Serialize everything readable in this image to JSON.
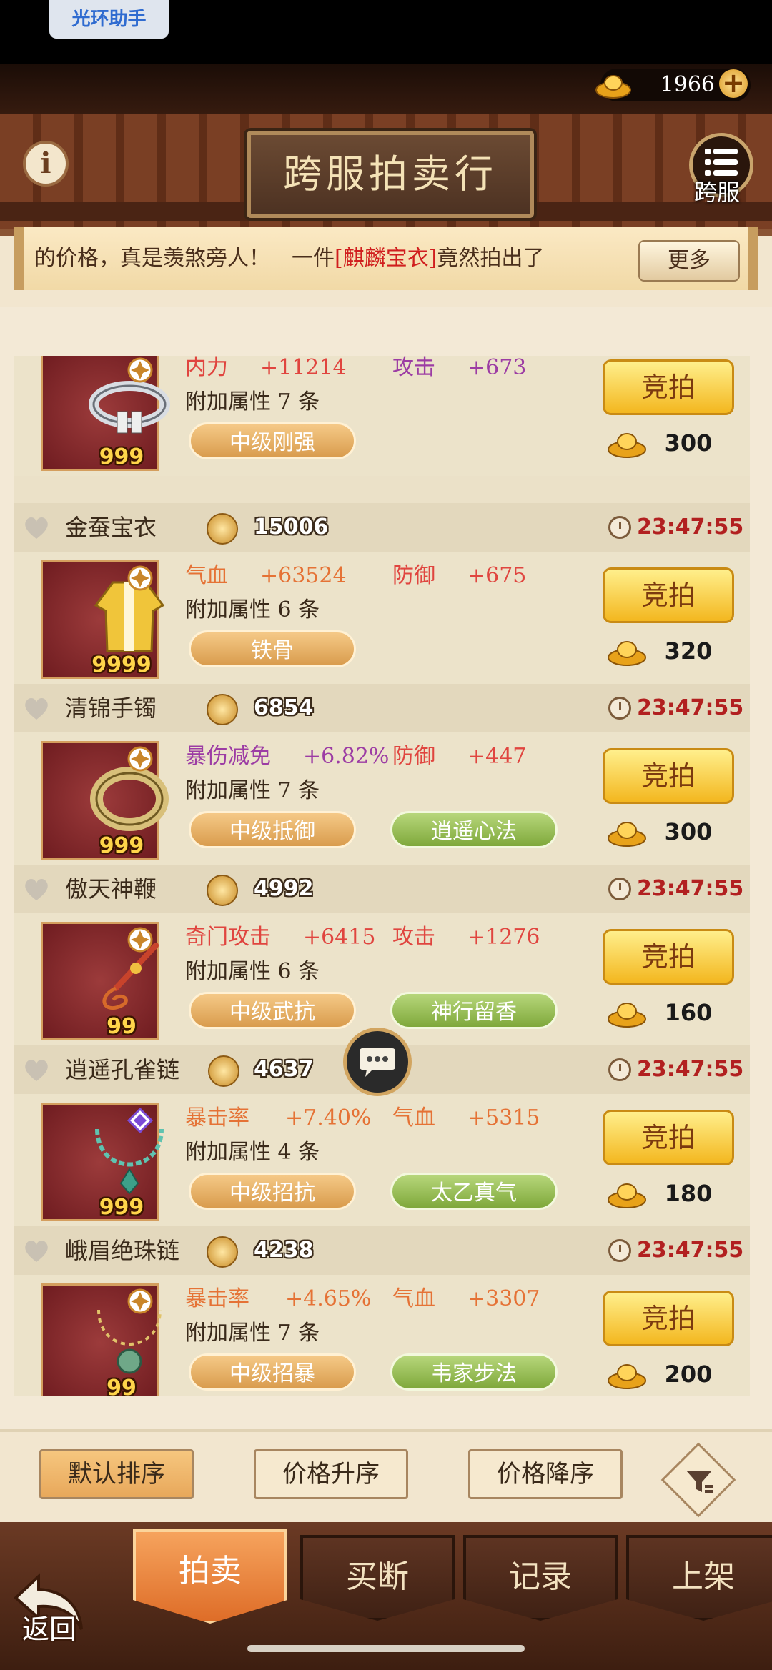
{
  "status_bar": {
    "helper_label": "光环助手"
  },
  "header": {
    "currency": "1966",
    "title": "跨服拍卖行",
    "server_label": "跨服"
  },
  "banner": {
    "text_pre": "的价格，真是羡煞旁人！　一件",
    "text_highlight": "[麒麟宝衣]",
    "text_post": "竟然拍出了",
    "more_label": "更多"
  },
  "items": [
    {
      "name": "",
      "price": "",
      "time": "",
      "stat1_name": "内力",
      "stat1_val": "+11214",
      "stat2_name": "攻击",
      "stat2_val": "+673",
      "extra": "附加属性 7 条",
      "tag1": "中级刚强",
      "tag2": "",
      "qty": "999",
      "bid_label": "竞拍",
      "bid_price": "300"
    },
    {
      "name": "金蚕宝衣",
      "price": "15006",
      "time": "23:47:55",
      "stat1_name": "气血",
      "stat1_val": "+63524",
      "stat2_name": "防御",
      "stat2_val": "+675",
      "extra": "附加属性 6 条",
      "tag1": "铁骨",
      "tag2": "",
      "qty": "9999",
      "bid_label": "竞拍",
      "bid_price": "320"
    },
    {
      "name": "清锦手镯",
      "price": "6854",
      "time": "23:47:55",
      "stat1_name": "暴伤减免",
      "stat1_val": "+6.82%",
      "stat2_name": "防御",
      "stat2_val": "+447",
      "extra": "附加属性 7 条",
      "tag1": "中级抵御",
      "tag2": "逍遥心法",
      "qty": "999",
      "bid_label": "竞拍",
      "bid_price": "300"
    },
    {
      "name": "傲天神鞭",
      "price": "4992",
      "time": "23:47:55",
      "stat1_name": "奇门攻击",
      "stat1_val": "+6415",
      "stat2_name": "攻击",
      "stat2_val": "+1276",
      "extra": "附加属性 6 条",
      "tag1": "中级武抗",
      "tag2": "神行留香",
      "qty": "99",
      "bid_label": "竞拍",
      "bid_price": "160"
    },
    {
      "name": "逍遥孔雀链",
      "price": "4637",
      "time": "23:47:55",
      "stat1_name": "暴击率",
      "stat1_val": "+7.40%",
      "stat2_name": "气血",
      "stat2_val": "+5315",
      "extra": "附加属性 4 条",
      "tag1": "中级招抗",
      "tag2": "太乙真气",
      "qty": "999",
      "bid_label": "竞拍",
      "bid_price": "180"
    },
    {
      "name": "峨眉绝珠链",
      "price": "4238",
      "time": "23:47:55",
      "stat1_name": "暴击率",
      "stat1_val": "+4.65%",
      "stat2_name": "气血",
      "stat2_val": "+3307",
      "extra": "附加属性 7 条",
      "tag1": "中级招暴",
      "tag2": "韦家步法",
      "qty": "99",
      "bid_label": "竞拍",
      "bid_price": "200"
    }
  ],
  "sort": {
    "default": "默认排序",
    "asc": "价格升序",
    "desc": "价格降序"
  },
  "nav": {
    "auction": "拍卖",
    "buyout": "买断",
    "records": "记录",
    "list": "上架",
    "back": "返回"
  },
  "colors": {
    "accent": "#f3b71f",
    "price_time": "#b22020",
    "pill_orange": "#d99c4d",
    "pill_green": "#7fa83b"
  }
}
